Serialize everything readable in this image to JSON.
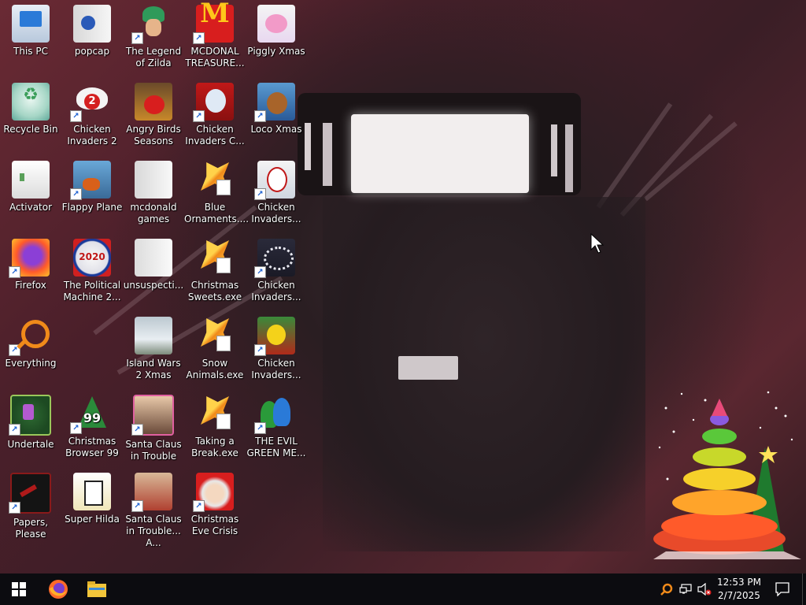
{
  "desktop": {
    "icons": [
      {
        "id": "this-pc",
        "label": "This PC"
      },
      {
        "id": "recycle-bin",
        "label": "Recycle Bin"
      },
      {
        "id": "activator",
        "label": "Activator"
      },
      {
        "id": "firefox",
        "label": "Firefox"
      },
      {
        "id": "everything",
        "label": "Everything"
      },
      {
        "id": "undertale",
        "label": "Undertale"
      },
      {
        "id": "papers-please",
        "label": "Papers, Please"
      },
      {
        "id": "popcap",
        "label": "popcap"
      },
      {
        "id": "chicken-invaders-2",
        "label": "Chicken Invaders 2"
      },
      {
        "id": "flappy-plane",
        "label": "Flappy Plane"
      },
      {
        "id": "political-machine",
        "label": "The Political Machine 2..."
      },
      {
        "id": "christmas-browser-99",
        "label": "Christmas Browser 99"
      },
      {
        "id": "super-hilda",
        "label": "Super Hilda"
      },
      {
        "id": "legend-of-zilda",
        "label": "The Legend of Zilda"
      },
      {
        "id": "angry-birds-seasons",
        "label": "Angry Birds Seasons"
      },
      {
        "id": "mcdonald-games",
        "label": "mcdonald games"
      },
      {
        "id": "unsuspecti",
        "label": "unsuspecti..."
      },
      {
        "id": "island-wars-2-xmas",
        "label": "Island Wars 2 Xmas"
      },
      {
        "id": "santa-claus-in-trouble",
        "label": "Santa Claus in Trouble"
      },
      {
        "id": "santa-claus-in-trouble-a",
        "label": "Santa Claus in Trouble... A..."
      },
      {
        "id": "mcdonal-treasure",
        "label": "MCDONAL TREASURE..."
      },
      {
        "id": "chicken-invaders-c",
        "label": "Chicken Invaders C..."
      },
      {
        "id": "blue-ornaments",
        "label": "Blue Ornaments...."
      },
      {
        "id": "christmas-sweets",
        "label": "Christmas Sweets.exe"
      },
      {
        "id": "snow-animals",
        "label": "Snow Animals.exe"
      },
      {
        "id": "taking-a-break",
        "label": "Taking a Break.exe"
      },
      {
        "id": "christmas-eve-crisis",
        "label": "Christmas Eve Crisis"
      },
      {
        "id": "piggly-xmas",
        "label": "Piggly Xmas"
      },
      {
        "id": "loco-xmas",
        "label": "Loco Xmas"
      },
      {
        "id": "chicken-invaders-xmas",
        "label": "Chicken Invaders..."
      },
      {
        "id": "chicken-invaders-m",
        "label": "Chicken Invaders..."
      },
      {
        "id": "chicken-invaders-g",
        "label": "Chicken Invaders..."
      },
      {
        "id": "the-evil-green",
        "label": "THE EVIL GREEN ME..."
      }
    ]
  },
  "taskbar": {
    "start_icon": "windows-logo-icon",
    "pinned": [
      "firefox-icon",
      "file-explorer-icon"
    ],
    "tray_icons": [
      "everything-tray-icon",
      "network-icon",
      "volume-muted-icon"
    ],
    "clock": {
      "time": "12:53 PM",
      "date": "2/7/2025"
    },
    "notification_icon": "action-center-icon"
  },
  "colors": {
    "taskbar": "#0c0c10",
    "icon_text": "#ffffff"
  }
}
